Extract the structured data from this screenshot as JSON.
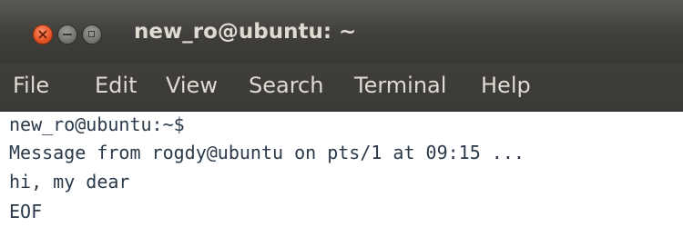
{
  "window": {
    "title": "new_ro@ubuntu: ~"
  },
  "menu": {
    "items": [
      "File",
      "Edit",
      "View",
      "Search",
      "Terminal",
      "Help"
    ]
  },
  "terminal": {
    "lines": [
      "new_ro@ubuntu:~$",
      "Message from rogdy@ubuntu on pts/1 at 09:15 ...",
      "hi, my dear",
      "EOF"
    ]
  },
  "colors": {
    "titlebar": "#3f3e3a",
    "title_text": "#dfdbd2",
    "close_button": "#e9582a",
    "terminal_bg": "#ffffff",
    "terminal_text": "#2b3a4a"
  },
  "icons": {
    "close": "close-icon",
    "minimize": "minimize-icon",
    "maximize": "maximize-icon"
  }
}
